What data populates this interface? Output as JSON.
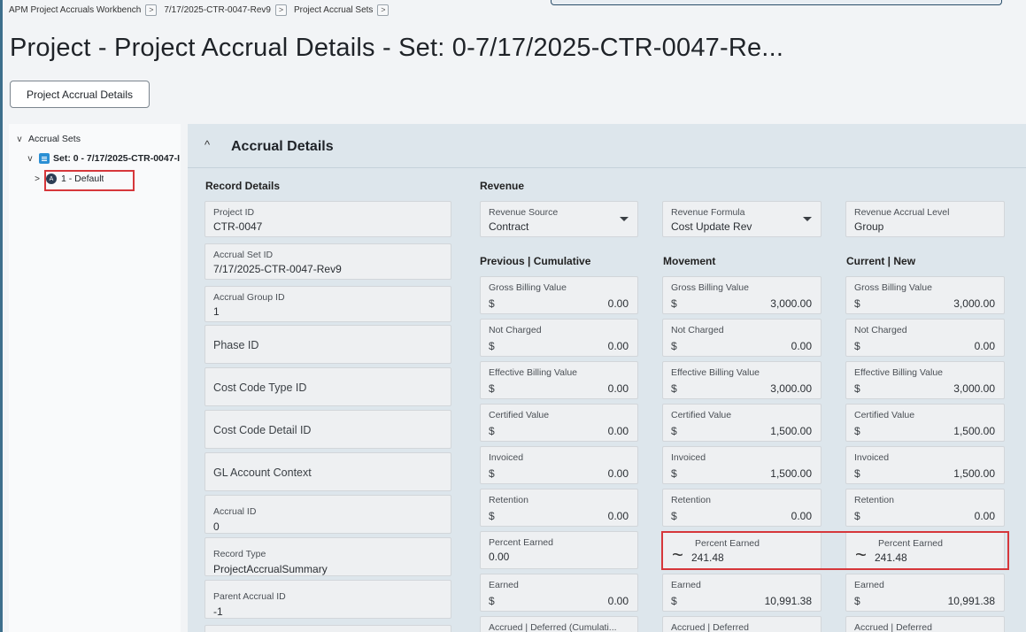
{
  "breadcrumb": [
    "APM Project Accruals Workbench",
    "7/17/2025-CTR-0047-Rev9",
    "Project Accrual Sets"
  ],
  "breadcrumb_sep": ">",
  "page_title": "Project - Project Accrual Details - Set: 0-7/17/2025-CTR-0047-Re...",
  "header_button": "Project Accrual Details",
  "tree": {
    "root": "Accrual Sets",
    "set": "Set: 0 - 7/17/2025-CTR-0047-I",
    "group_badge": "A",
    "group": "1 - Default"
  },
  "section": {
    "title": "Accrual Details",
    "record_details_label": "Record Details",
    "revenue_label": "Revenue",
    "previous_label": "Previous | Cumulative",
    "movement_label": "Movement",
    "current_label": "Current | New"
  },
  "record": [
    {
      "label": "Project ID",
      "value": "CTR-0047"
    },
    {
      "label": "Accrual Set ID",
      "value": "7/17/2025-CTR-0047-Rev9"
    },
    {
      "label": "Accrual Group ID",
      "value": "1"
    },
    {
      "label": "Phase ID",
      "value": ""
    },
    {
      "label": "Cost Code Type ID",
      "value": ""
    },
    {
      "label": "Cost Code Detail ID",
      "value": ""
    },
    {
      "label": "GL Account Context",
      "value": ""
    },
    {
      "label": "Accrual ID",
      "value": "0"
    },
    {
      "label": "Record Type",
      "value": "ProjectAccrualSummary"
    },
    {
      "label": "Parent Accrual ID",
      "value": "-1"
    }
  ],
  "revenue": {
    "source": {
      "label": "Revenue Source",
      "value": "Contract"
    },
    "formula": {
      "label": "Revenue Formula",
      "value": "Cost Update Rev"
    },
    "level": {
      "label": "Revenue Accrual Level",
      "value": "Group"
    }
  },
  "currency": "$",
  "previous": [
    {
      "label": "Gross Billing Value",
      "value": "0.00"
    },
    {
      "label": "Not Charged",
      "value": "0.00"
    },
    {
      "label": "Effective Billing Value",
      "value": "0.00"
    },
    {
      "label": "Certified Value",
      "value": "0.00"
    },
    {
      "label": "Invoiced",
      "value": "0.00"
    },
    {
      "label": "Retention",
      "value": "0.00"
    },
    {
      "label": "Percent Earned",
      "value": "0.00"
    },
    {
      "label": "Earned",
      "value": "0.00"
    },
    {
      "label": "Accrued | Deferred (Cumulati...",
      "value": ""
    }
  ],
  "movement": [
    {
      "label": "Gross Billing Value",
      "value": "3,000.00"
    },
    {
      "label": "Not Charged",
      "value": "0.00"
    },
    {
      "label": "Effective Billing Value",
      "value": "3,000.00"
    },
    {
      "label": "Certified Value",
      "value": "1,500.00"
    },
    {
      "label": "Invoiced",
      "value": "1,500.00"
    },
    {
      "label": "Retention",
      "value": "0.00"
    },
    {
      "label": "Percent Earned",
      "value": "241.48"
    },
    {
      "label": "Earned",
      "value": "10,991.38"
    },
    {
      "label": "Accrued | Deferred",
      "value": ""
    }
  ],
  "current": [
    {
      "label": "Gross Billing Value",
      "value": "3,000.00"
    },
    {
      "label": "Not Charged",
      "value": "0.00"
    },
    {
      "label": "Effective Billing Value",
      "value": "3,000.00"
    },
    {
      "label": "Certified Value",
      "value": "1,500.00"
    },
    {
      "label": "Invoiced",
      "value": "1,500.00"
    },
    {
      "label": "Retention",
      "value": "0.00"
    },
    {
      "label": "Percent Earned",
      "value": "241.48"
    },
    {
      "label": "Earned",
      "value": "10,991.38"
    },
    {
      "label": "Accrued | Deferred",
      "value": ""
    }
  ],
  "icons": {
    "tilde": "~",
    "collapse": "^",
    "tree_expanded": "v",
    "tree_collapsed": ">"
  },
  "colors": {
    "highlight": "#d6373b",
    "panel": "#dde6ec",
    "set_icon": "#2a8fd4"
  }
}
